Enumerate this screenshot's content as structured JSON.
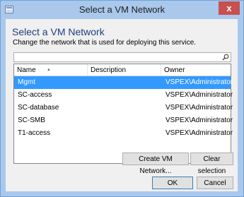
{
  "window": {
    "title": "Select a VM Network",
    "close_glyph": "x"
  },
  "heading": "Select a VM Network",
  "description": "Change the network that is used for deploying this service.",
  "search": {
    "value": "",
    "placeholder": ""
  },
  "table": {
    "columns": [
      "Name",
      "Description",
      "Owner"
    ],
    "sort_column": "Name",
    "rows": [
      {
        "name": "Mgmt",
        "description": "",
        "owner": "VSPEX\\Administrator",
        "selected": true
      },
      {
        "name": "SC-access",
        "description": "",
        "owner": "VSPEX\\Administrator",
        "selected": false
      },
      {
        "name": "SC-database",
        "description": "",
        "owner": "VSPEX\\Administrator",
        "selected": false
      },
      {
        "name": "SC-SMB",
        "description": "",
        "owner": "VSPEX\\Administrator",
        "selected": false
      },
      {
        "name": "T1-access",
        "description": "",
        "owner": "VSPEX\\Administrator",
        "selected": false
      }
    ]
  },
  "buttons": {
    "create": "Create VM Network...",
    "clear": "Clear selection",
    "ok": "OK",
    "cancel": "Cancel"
  },
  "colors": {
    "titlebar": "#a9c8ec",
    "close": "#c75050",
    "selection": "#3399ff",
    "heading": "#1c3f7c"
  },
  "icons": {
    "app": "vm-network-app-icon",
    "search": "search-icon",
    "close": "close-icon",
    "sort": "sort-ascending-icon"
  }
}
